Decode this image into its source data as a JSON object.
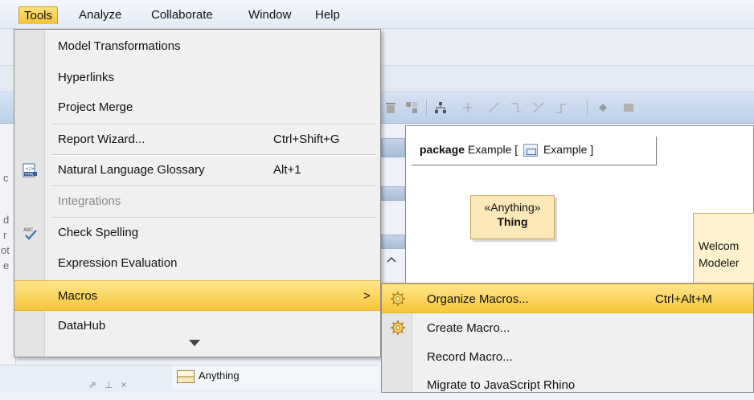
{
  "menubar": {
    "items": [
      {
        "label": "Tools"
      },
      {
        "label": "Analyze"
      },
      {
        "label": "Collaborate"
      },
      {
        "label": "Window"
      },
      {
        "label": "Help"
      }
    ]
  },
  "tools_menu": {
    "items": [
      {
        "label": "Model Transformations"
      },
      {
        "label": "Hyperlinks"
      },
      {
        "label": "Project Merge"
      },
      {
        "label": "Report Wizard...",
        "shortcut": "Ctrl+Shift+G"
      },
      {
        "label": "Natural Language Glossary",
        "shortcut": "Alt+1",
        "icon": "html-icon"
      },
      {
        "label": "Integrations",
        "disabled": true
      },
      {
        "label": "Check Spelling",
        "icon": "spell-check-icon"
      },
      {
        "label": "Expression Evaluation"
      },
      {
        "label": "Macros",
        "submenu_arrow": ">"
      },
      {
        "label": "DataHub"
      }
    ]
  },
  "macros_menu": {
    "items": [
      {
        "label": "Organize Macros...",
        "shortcut": "Ctrl+Alt+M",
        "icon": "gear-icon"
      },
      {
        "label": "Create Macro...",
        "icon": "gear-icon"
      },
      {
        "label": "Record Macro..."
      },
      {
        "label": "Migrate to JavaScript Rhino"
      }
    ]
  },
  "diagram": {
    "package_keyword": "package",
    "package_name": "Example",
    "package_bracket_open": "[",
    "package_ref": "Example",
    "package_bracket_close": "]",
    "element_stereotype": "«Anything»",
    "element_name": "Thing",
    "note_line1": "Welcom",
    "note_line2": "Modeler"
  },
  "left_panel": {
    "letters": [
      "c",
      "d",
      "r",
      "ot",
      "e"
    ]
  },
  "bottom_panel": {
    "item_label": "Anything"
  },
  "colors": {
    "menu_highlight": "#f6c63a",
    "menu_background": "#f0f0f0",
    "element_fill": "#fbe7b8",
    "toolbar": "#bcd0e9"
  }
}
